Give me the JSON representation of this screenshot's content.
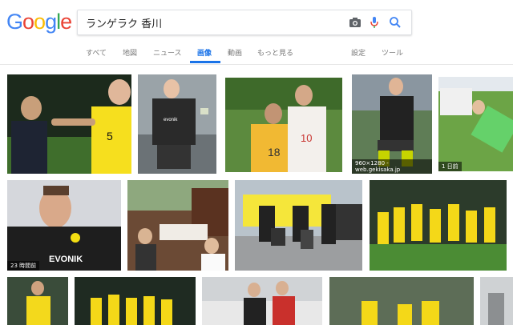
{
  "logo": {
    "letters": [
      "G",
      "o",
      "o",
      "g",
      "l",
      "e"
    ],
    "colors": [
      "#4285F4",
      "#EA4335",
      "#FBBC05",
      "#4285F4",
      "#34A853",
      "#EA4335"
    ]
  },
  "search": {
    "query": "ランゲラク 香川",
    "icons": [
      "camera-icon",
      "mic-icon",
      "search-icon"
    ]
  },
  "tabs": [
    {
      "label": "すべて",
      "active": false
    },
    {
      "label": "地図",
      "active": false
    },
    {
      "label": "ニュース",
      "active": false
    },
    {
      "label": "画像",
      "active": true
    },
    {
      "label": "動画",
      "active": false
    },
    {
      "label": "もっと見る",
      "active": false
    },
    {
      "label": "設定",
      "active": false
    },
    {
      "label": "ツール",
      "active": false
    }
  ],
  "accent": "#1a73e8",
  "results": [
    {
      "caption": ""
    },
    {
      "caption": ""
    },
    {
      "caption": ""
    },
    {
      "caption": "960×1280 - web.gekisaka.jp"
    },
    {
      "caption": "1 日前"
    },
    {
      "caption": "23 時間前"
    },
    {
      "caption": ""
    },
    {
      "caption": ""
    },
    {
      "caption": ""
    },
    {
      "caption": ""
    },
    {
      "caption": ""
    },
    {
      "caption": ""
    },
    {
      "caption": ""
    },
    {
      "caption": ""
    },
    {
      "caption": ""
    }
  ],
  "jersey": {
    "number_1": "5",
    "number_2": "18",
    "number_3": "10",
    "sponsor": "EVONIK",
    "sponsor_2": "evonik"
  }
}
